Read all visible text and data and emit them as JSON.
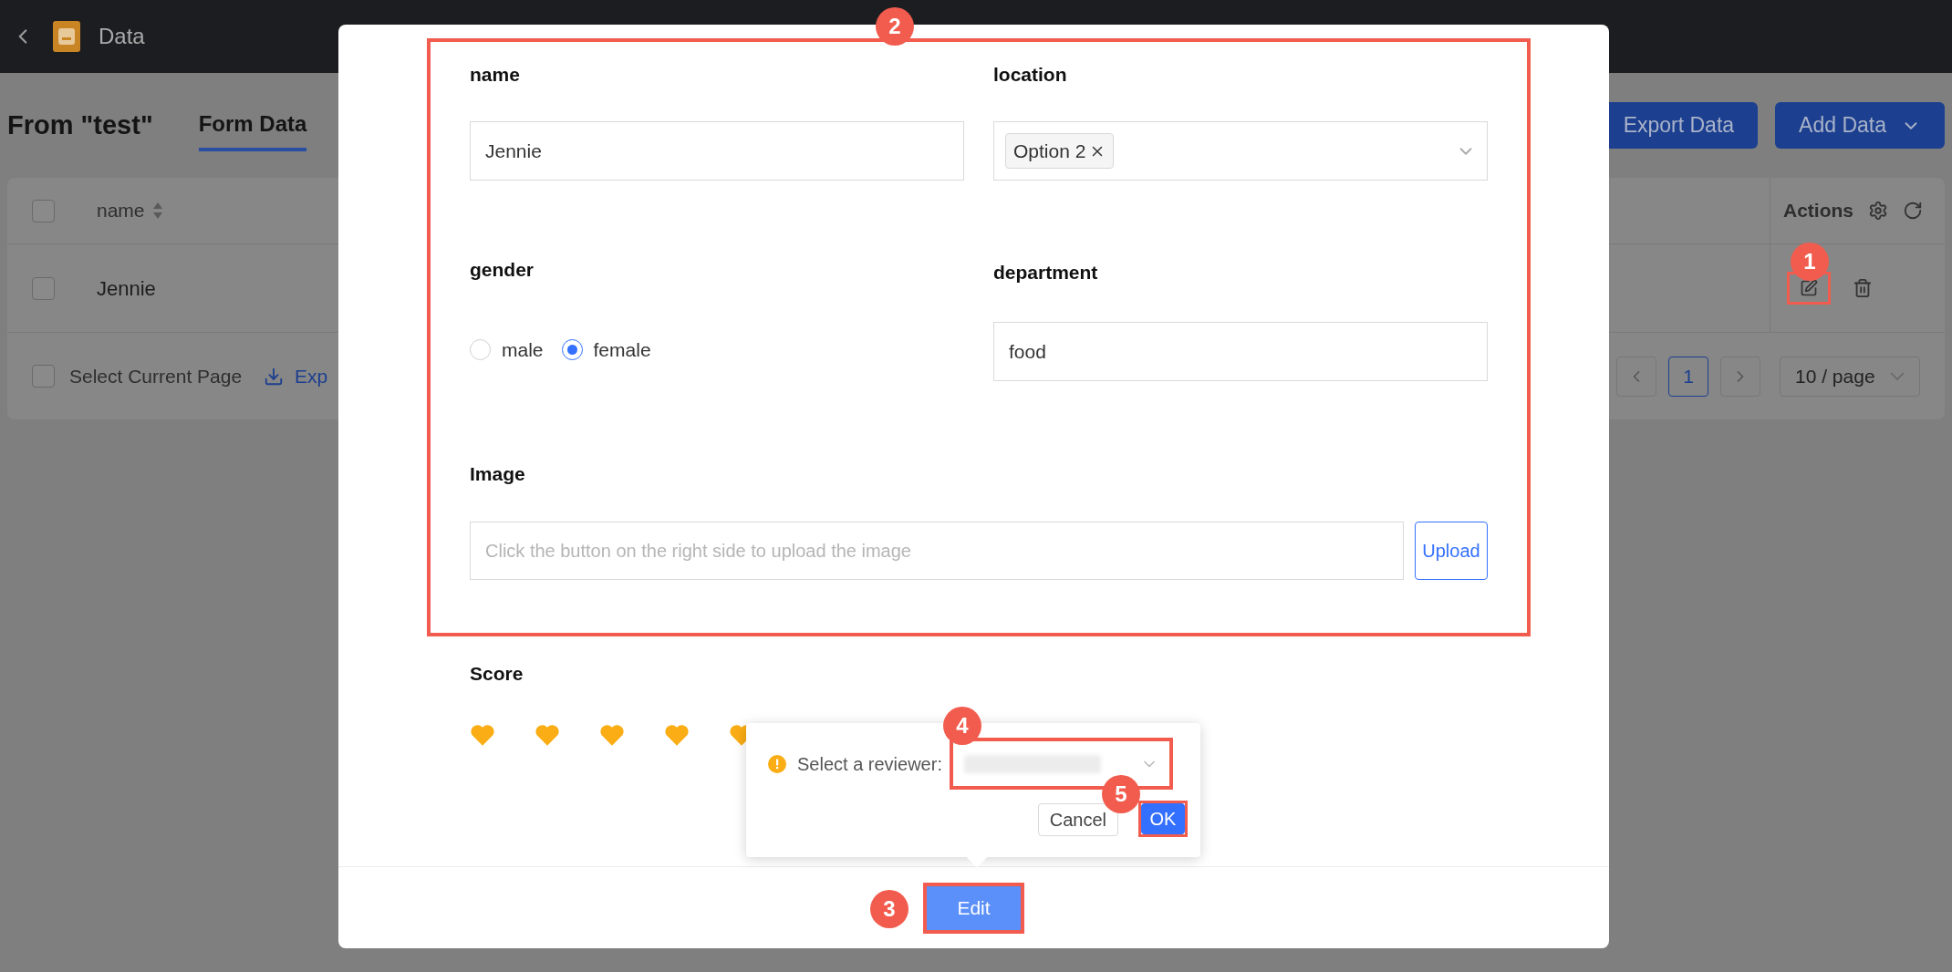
{
  "header": {
    "title": "Data"
  },
  "page": {
    "title": "From \"test\"",
    "tabs": [
      {
        "label": "Form Data",
        "selected": true
      }
    ],
    "buttons": [
      {
        "label": "Export Data"
      },
      {
        "label": "Add Data"
      }
    ]
  },
  "table": {
    "header_checked": false,
    "columns": [
      {
        "label": "name"
      }
    ],
    "actions_label": "Actions",
    "rows": [
      {
        "name": "Jennie",
        "checked": false
      }
    ]
  },
  "footer": {
    "select_label": "Select Current Page",
    "select_checked": false,
    "export_label": "Exp",
    "pages": [
      {
        "label": "1",
        "selected": true
      }
    ],
    "page_size": "10 / page"
  },
  "form": {
    "name": {
      "label": "name",
      "value": "Jennie"
    },
    "location": {
      "label": "location",
      "tags": [
        "Option 2"
      ]
    },
    "gender": {
      "label": "gender",
      "options": [
        {
          "label": "male",
          "selected": false
        },
        {
          "label": "female",
          "selected": true
        }
      ]
    },
    "department": {
      "label": "department",
      "value": "food"
    },
    "image": {
      "label": "Image",
      "placeholder": "Click the button on the right side to upload the image",
      "button": "Upload"
    },
    "score": {
      "label": "Score",
      "stars": 5
    },
    "submit": "Edit"
  },
  "popover": {
    "message": "Select a reviewer:",
    "buttons": [
      {
        "label": "Cancel",
        "kind": "secondary"
      },
      {
        "label": "OK",
        "kind": "primary"
      }
    ]
  },
  "annotations": [
    {
      "label": "1"
    },
    {
      "label": "2"
    },
    {
      "label": "3"
    },
    {
      "label": "4"
    },
    {
      "label": "5"
    }
  ]
}
